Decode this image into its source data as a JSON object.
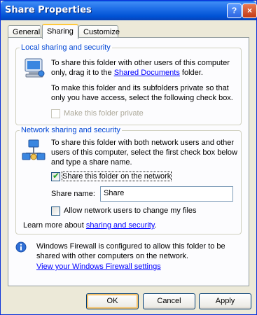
{
  "window": {
    "title": "Share Properties"
  },
  "titlebar": {
    "help_glyph": "?",
    "close_glyph": "×"
  },
  "tabs": [
    {
      "label": "General"
    },
    {
      "label": "Sharing"
    },
    {
      "label": "Customize"
    }
  ],
  "local": {
    "heading": "Local sharing and security",
    "para1_before": "To share this folder with other users of this computer only, drag it to the ",
    "para1_link": "Shared Documents",
    "para1_after": " folder.",
    "para2": "To make this folder and its subfolders private so that only you have access, select the following check box.",
    "private_label": "Make this folder private",
    "private_checked": false,
    "private_enabled": false
  },
  "network": {
    "heading": "Network sharing and security",
    "para": "To share this folder with both network users and other users of this computer, select the first check box below and type a share name.",
    "share_label": "Share this folder on the network",
    "share_checked": true,
    "share_name_label": "Share name:",
    "share_name_value": "Share",
    "allow_change_label": "Allow network users to change my files",
    "allow_change_checked": false,
    "learn_before": "Learn more about ",
    "learn_link": "sharing and security",
    "learn_after": "."
  },
  "firewall": {
    "text": "Windows Firewall is configured to allow this folder to be shared with other computers on the network.",
    "link": "View your Windows Firewall settings"
  },
  "buttons": {
    "ok": "OK",
    "cancel": "Cancel",
    "apply": "Apply"
  },
  "colors": {
    "group_heading": "#0046d5",
    "link": "#0000ff",
    "titlebar": "#0052d4"
  }
}
